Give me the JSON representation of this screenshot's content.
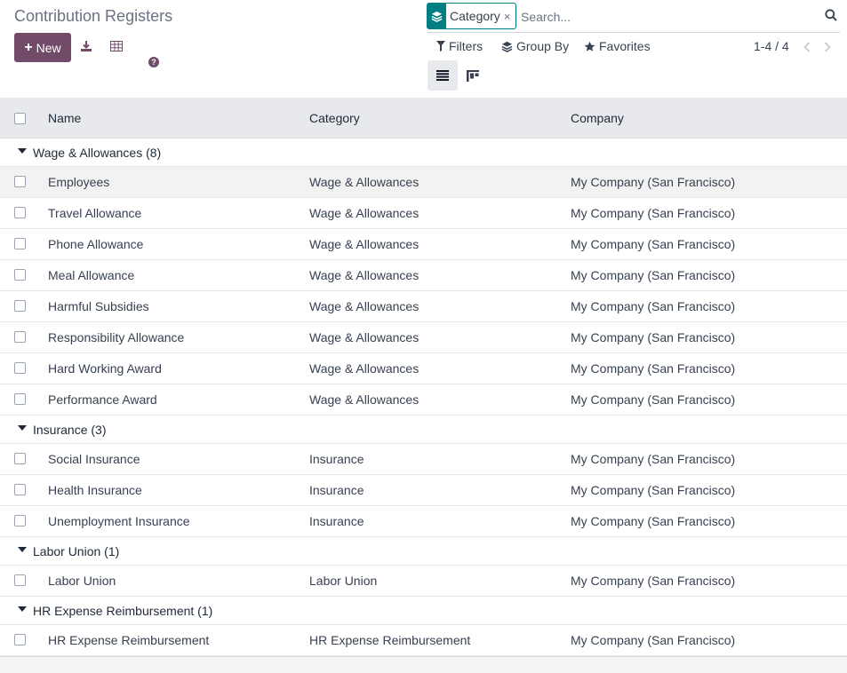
{
  "page": {
    "title": "Contribution Registers"
  },
  "toolbar": {
    "new_label": "New",
    "help_icon": "question-circle-icon",
    "download_icon": "download-icon",
    "spreadsheet_icon": "table-icon"
  },
  "search": {
    "facet_label": "Category",
    "facet_icon": "layers-icon",
    "placeholder": "Search...",
    "filters_label": "Filters",
    "groupby_label": "Group By",
    "favorites_label": "Favorites"
  },
  "pager": {
    "value": "1-4 / 4"
  },
  "colors": {
    "brand": "#714b67",
    "facet": "#017e84",
    "header_bg": "#e7e9ed"
  },
  "columns": [
    "Name",
    "Category",
    "Company"
  ],
  "groups": [
    {
      "label": "Wage & Allowances (8)",
      "rows": [
        {
          "name": "Employees",
          "category": "Wage & Allowances",
          "company": "My Company (San Francisco)"
        },
        {
          "name": "Travel Allowance",
          "category": "Wage & Allowances",
          "company": "My Company (San Francisco)"
        },
        {
          "name": "Phone Allowance",
          "category": "Wage & Allowances",
          "company": "My Company (San Francisco)"
        },
        {
          "name": "Meal Allowance",
          "category": "Wage & Allowances",
          "company": "My Company (San Francisco)"
        },
        {
          "name": "Harmful Subsidies",
          "category": "Wage & Allowances",
          "company": "My Company (San Francisco)"
        },
        {
          "name": "Responsibility Allowance",
          "category": "Wage & Allowances",
          "company": "My Company (San Francisco)"
        },
        {
          "name": "Hard Working Award",
          "category": "Wage & Allowances",
          "company": "My Company (San Francisco)"
        },
        {
          "name": "Performance Award",
          "category": "Wage & Allowances",
          "company": "My Company (San Francisco)"
        }
      ]
    },
    {
      "label": "Insurance (3)",
      "rows": [
        {
          "name": "Social Insurance",
          "category": "Insurance",
          "company": "My Company (San Francisco)"
        },
        {
          "name": "Health Insurance",
          "category": "Insurance",
          "company": "My Company (San Francisco)"
        },
        {
          "name": "Unemployment Insurance",
          "category": "Insurance",
          "company": "My Company (San Francisco)"
        }
      ]
    },
    {
      "label": "Labor Union (1)",
      "rows": [
        {
          "name": "Labor Union",
          "category": "Labor Union",
          "company": "My Company (San Francisco)"
        }
      ]
    },
    {
      "label": "HR Expense Reimbursement (1)",
      "rows": [
        {
          "name": "HR Expense Reimbursement",
          "category": "HR Expense Reimbursement",
          "company": "My Company (San Francisco)"
        }
      ]
    }
  ]
}
